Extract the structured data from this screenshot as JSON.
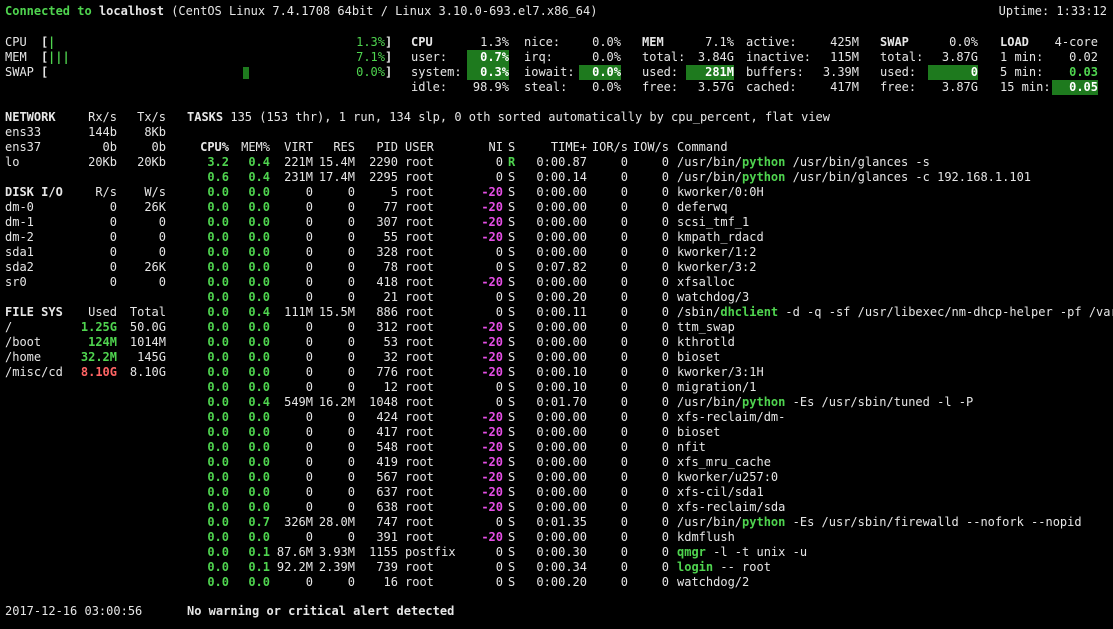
{
  "header": {
    "connected_label": "Connected to",
    "host": "localhost",
    "system": "(CentOS Linux 7.4.1708 64bit / Linux 3.10.0-693.el7.x86_64)",
    "uptime": "Uptime: 1:33:12"
  },
  "quicklook": [
    {
      "label": "CPU",
      "value": "1.3%",
      "fraction": 0.013
    },
    {
      "label": "MEM",
      "value": "7.1%",
      "fraction": 0.071
    },
    {
      "label": "SWAP",
      "value": "0.0%",
      "fraction": 0.0
    }
  ],
  "cpu": {
    "title": "CPU",
    "total": "1.3%",
    "rows": [
      {
        "k1": "user:",
        "v1": "0.7%",
        "k2": "nice:",
        "v2": "0.0%"
      },
      {
        "k1": "system:",
        "v1": "0.3%",
        "k2": "irq:",
        "v2": "0.0%"
      },
      {
        "k1": "idle:",
        "v1": "98.9%",
        "k2": "iowait:",
        "v2": "0.0%"
      },
      {
        "k1": "",
        "v1": "",
        "k2": "steal:",
        "v2": "0.0%"
      }
    ]
  },
  "mem": {
    "title": "MEM",
    "total": "7.1%",
    "rows": [
      {
        "k1": "total:",
        "v1": "3.84G",
        "k2": "active:",
        "v2": "425M"
      },
      {
        "k1": "used:",
        "v1": "281M",
        "k2": "inactive:",
        "v2": "115M"
      },
      {
        "k1": "free:",
        "v1": "3.57G",
        "k2": "buffers:",
        "v2": "3.39M"
      },
      {
        "k1": "",
        "v1": "",
        "k2": "cached:",
        "v2": "417M"
      }
    ]
  },
  "swap": {
    "title": "SWAP",
    "total": "0.0%",
    "rows": [
      {
        "k": "total:",
        "v": "3.87G"
      },
      {
        "k": "used:",
        "v": "0"
      },
      {
        "k": "free:",
        "v": "3.87G"
      }
    ]
  },
  "load": {
    "title": "LOAD",
    "cores": "4-core",
    "rows": [
      {
        "k": "1 min:",
        "v": "0.02"
      },
      {
        "k": "5 min:",
        "v": "0.03"
      },
      {
        "k": "15 min:",
        "v": "0.05"
      }
    ]
  },
  "network": {
    "title": "NETWORK",
    "rx_label": "Rx/s",
    "tx_label": "Tx/s",
    "rows": [
      {
        "name": "ens33",
        "rx": "144b",
        "tx": "8Kb"
      },
      {
        "name": "ens37",
        "rx": "0b",
        "tx": "0b"
      },
      {
        "name": "lo",
        "rx": "20Kb",
        "tx": "20Kb"
      }
    ]
  },
  "diskio": {
    "title": "DISK I/O",
    "r_label": "R/s",
    "w_label": "W/s",
    "rows": [
      {
        "name": "dm-0",
        "r": "0",
        "w": "26K"
      },
      {
        "name": "dm-1",
        "r": "0",
        "w": "0"
      },
      {
        "name": "dm-2",
        "r": "0",
        "w": "0"
      },
      {
        "name": "sda1",
        "r": "0",
        "w": "0"
      },
      {
        "name": "sda2",
        "r": "0",
        "w": "26K"
      },
      {
        "name": "sr0",
        "r": "0",
        "w": "0"
      }
    ]
  },
  "fs": {
    "title": "FILE SYS",
    "used_label": "Used",
    "total_label": "Total",
    "rows": [
      {
        "name": "/",
        "used": "1.25G",
        "total": "50.0G",
        "level": "ok"
      },
      {
        "name": "/boot",
        "used": "124M",
        "total": "1014M",
        "level": "ok"
      },
      {
        "name": "/home",
        "used": "32.2M",
        "total": "145G",
        "level": "ok"
      },
      {
        "name": "/misc/cd",
        "used": "8.10G",
        "total": "8.10G",
        "level": "critical"
      }
    ]
  },
  "tasks": {
    "title": "TASKS",
    "summary": "135 (153 thr), 1 run, 134 slp, 0 oth sorted automatically by cpu_percent, flat view"
  },
  "proc_headers": {
    "cpu": "CPU%",
    "mem": "MEM%",
    "virt": "VIRT",
    "res": "RES",
    "pid": "PID",
    "user": "USER",
    "ni": "NI",
    "s": "S",
    "time": "TIME+",
    "ior": "IOR/s",
    "iow": "IOW/s",
    "cmd": "Command"
  },
  "processes": [
    {
      "cpu": "3.2",
      "mem": "0.4",
      "virt": "221M",
      "res": "15.4M",
      "pid": "2290",
      "user": "root",
      "ni": "0",
      "s": "R",
      "time": "0:00.87",
      "ior": "0",
      "iow": "0",
      "cmd_pre": "/usr/bin/",
      "cmd_hl": "python",
      "cmd_post": " /usr/bin/glances -s"
    },
    {
      "cpu": "0.6",
      "mem": "0.4",
      "virt": "231M",
      "res": "17.4M",
      "pid": "2295",
      "user": "root",
      "ni": "0",
      "s": "S",
      "time": "0:00.14",
      "ior": "0",
      "iow": "0",
      "cmd_pre": "/usr/bin/",
      "cmd_hl": "python",
      "cmd_post": " /usr/bin/glances -c 192.168.1.101"
    },
    {
      "cpu": "0.0",
      "mem": "0.0",
      "virt": "0",
      "res": "0",
      "pid": "5",
      "user": "root",
      "ni": "-20",
      "s": "S",
      "time": "0:00.00",
      "ior": "0",
      "iow": "0",
      "cmd_pre": "kworker/0:0H",
      "cmd_hl": "",
      "cmd_post": ""
    },
    {
      "cpu": "0.0",
      "mem": "0.0",
      "virt": "0",
      "res": "0",
      "pid": "77",
      "user": "root",
      "ni": "-20",
      "s": "S",
      "time": "0:00.00",
      "ior": "0",
      "iow": "0",
      "cmd_pre": "deferwq",
      "cmd_hl": "",
      "cmd_post": ""
    },
    {
      "cpu": "0.0",
      "mem": "0.0",
      "virt": "0",
      "res": "0",
      "pid": "307",
      "user": "root",
      "ni": "-20",
      "s": "S",
      "time": "0:00.00",
      "ior": "0",
      "iow": "0",
      "cmd_pre": "scsi_tmf_1",
      "cmd_hl": "",
      "cmd_post": ""
    },
    {
      "cpu": "0.0",
      "mem": "0.0",
      "virt": "0",
      "res": "0",
      "pid": "55",
      "user": "root",
      "ni": "-20",
      "s": "S",
      "time": "0:00.00",
      "ior": "0",
      "iow": "0",
      "cmd_pre": "kmpath_rdacd",
      "cmd_hl": "",
      "cmd_post": ""
    },
    {
      "cpu": "0.0",
      "mem": "0.0",
      "virt": "0",
      "res": "0",
      "pid": "328",
      "user": "root",
      "ni": "0",
      "s": "S",
      "time": "0:00.00",
      "ior": "0",
      "iow": "0",
      "cmd_pre": "kworker/1:2",
      "cmd_hl": "",
      "cmd_post": ""
    },
    {
      "cpu": "0.0",
      "mem": "0.0",
      "virt": "0",
      "res": "0",
      "pid": "78",
      "user": "root",
      "ni": "0",
      "s": "S",
      "time": "0:07.82",
      "ior": "0",
      "iow": "0",
      "cmd_pre": "kworker/3:2",
      "cmd_hl": "",
      "cmd_post": ""
    },
    {
      "cpu": "0.0",
      "mem": "0.0",
      "virt": "0",
      "res": "0",
      "pid": "418",
      "user": "root",
      "ni": "-20",
      "s": "S",
      "time": "0:00.00",
      "ior": "0",
      "iow": "0",
      "cmd_pre": "xfsalloc",
      "cmd_hl": "",
      "cmd_post": ""
    },
    {
      "cpu": "0.0",
      "mem": "0.0",
      "virt": "0",
      "res": "0",
      "pid": "21",
      "user": "root",
      "ni": "0",
      "s": "S",
      "time": "0:00.20",
      "ior": "0",
      "iow": "0",
      "cmd_pre": "watchdog/3",
      "cmd_hl": "",
      "cmd_post": ""
    },
    {
      "cpu": "0.0",
      "mem": "0.4",
      "virt": "111M",
      "res": "15.5M",
      "pid": "886",
      "user": "root",
      "ni": "0",
      "s": "S",
      "time": "0:00.11",
      "ior": "0",
      "iow": "0",
      "cmd_pre": "/sbin/",
      "cmd_hl": "dhclient",
      "cmd_post": " -d -q -sf /usr/libexec/nm-dhcp-helper -pf /var"
    },
    {
      "cpu": "0.0",
      "mem": "0.0",
      "virt": "0",
      "res": "0",
      "pid": "312",
      "user": "root",
      "ni": "-20",
      "s": "S",
      "time": "0:00.00",
      "ior": "0",
      "iow": "0",
      "cmd_pre": "ttm_swap",
      "cmd_hl": "",
      "cmd_post": ""
    },
    {
      "cpu": "0.0",
      "mem": "0.0",
      "virt": "0",
      "res": "0",
      "pid": "53",
      "user": "root",
      "ni": "-20",
      "s": "S",
      "time": "0:00.00",
      "ior": "0",
      "iow": "0",
      "cmd_pre": "kthrotld",
      "cmd_hl": "",
      "cmd_post": ""
    },
    {
      "cpu": "0.0",
      "mem": "0.0",
      "virt": "0",
      "res": "0",
      "pid": "32",
      "user": "root",
      "ni": "-20",
      "s": "S",
      "time": "0:00.00",
      "ior": "0",
      "iow": "0",
      "cmd_pre": "bioset",
      "cmd_hl": "",
      "cmd_post": ""
    },
    {
      "cpu": "0.0",
      "mem": "0.0",
      "virt": "0",
      "res": "0",
      "pid": "776",
      "user": "root",
      "ni": "-20",
      "s": "S",
      "time": "0:00.10",
      "ior": "0",
      "iow": "0",
      "cmd_pre": "kworker/3:1H",
      "cmd_hl": "",
      "cmd_post": ""
    },
    {
      "cpu": "0.0",
      "mem": "0.0",
      "virt": "0",
      "res": "0",
      "pid": "12",
      "user": "root",
      "ni": "0",
      "s": "S",
      "time": "0:00.10",
      "ior": "0",
      "iow": "0",
      "cmd_pre": "migration/1",
      "cmd_hl": "",
      "cmd_post": ""
    },
    {
      "cpu": "0.0",
      "mem": "0.4",
      "virt": "549M",
      "res": "16.2M",
      "pid": "1048",
      "user": "root",
      "ni": "0",
      "s": "S",
      "time": "0:01.70",
      "ior": "0",
      "iow": "0",
      "cmd_pre": "/usr/bin/",
      "cmd_hl": "python",
      "cmd_post": " -Es /usr/sbin/tuned -l -P"
    },
    {
      "cpu": "0.0",
      "mem": "0.0",
      "virt": "0",
      "res": "0",
      "pid": "424",
      "user": "root",
      "ni": "-20",
      "s": "S",
      "time": "0:00.00",
      "ior": "0",
      "iow": "0",
      "cmd_pre": "xfs-reclaim/dm-",
      "cmd_hl": "",
      "cmd_post": ""
    },
    {
      "cpu": "0.0",
      "mem": "0.0",
      "virt": "0",
      "res": "0",
      "pid": "417",
      "user": "root",
      "ni": "-20",
      "s": "S",
      "time": "0:00.00",
      "ior": "0",
      "iow": "0",
      "cmd_pre": "bioset",
      "cmd_hl": "",
      "cmd_post": ""
    },
    {
      "cpu": "0.0",
      "mem": "0.0",
      "virt": "0",
      "res": "0",
      "pid": "548",
      "user": "root",
      "ni": "-20",
      "s": "S",
      "time": "0:00.00",
      "ior": "0",
      "iow": "0",
      "cmd_pre": "nfit",
      "cmd_hl": "",
      "cmd_post": ""
    },
    {
      "cpu": "0.0",
      "mem": "0.0",
      "virt": "0",
      "res": "0",
      "pid": "419",
      "user": "root",
      "ni": "-20",
      "s": "S",
      "time": "0:00.00",
      "ior": "0",
      "iow": "0",
      "cmd_pre": "xfs_mru_cache",
      "cmd_hl": "",
      "cmd_post": ""
    },
    {
      "cpu": "0.0",
      "mem": "0.0",
      "virt": "0",
      "res": "0",
      "pid": "567",
      "user": "root",
      "ni": "-20",
      "s": "S",
      "time": "0:00.00",
      "ior": "0",
      "iow": "0",
      "cmd_pre": "kworker/u257:0",
      "cmd_hl": "",
      "cmd_post": ""
    },
    {
      "cpu": "0.0",
      "mem": "0.0",
      "virt": "0",
      "res": "0",
      "pid": "637",
      "user": "root",
      "ni": "-20",
      "s": "S",
      "time": "0:00.00",
      "ior": "0",
      "iow": "0",
      "cmd_pre": "xfs-cil/sda1",
      "cmd_hl": "",
      "cmd_post": ""
    },
    {
      "cpu": "0.0",
      "mem": "0.0",
      "virt": "0",
      "res": "0",
      "pid": "638",
      "user": "root",
      "ni": "-20",
      "s": "S",
      "time": "0:00.00",
      "ior": "0",
      "iow": "0",
      "cmd_pre": "xfs-reclaim/sda",
      "cmd_hl": "",
      "cmd_post": ""
    },
    {
      "cpu": "0.0",
      "mem": "0.7",
      "virt": "326M",
      "res": "28.0M",
      "pid": "747",
      "user": "root",
      "ni": "0",
      "s": "S",
      "time": "0:01.35",
      "ior": "0",
      "iow": "0",
      "cmd_pre": "/usr/bin/",
      "cmd_hl": "python",
      "cmd_post": " -Es /usr/sbin/firewalld --nofork --nopid"
    },
    {
      "cpu": "0.0",
      "mem": "0.0",
      "virt": "0",
      "res": "0",
      "pid": "391",
      "user": "root",
      "ni": "-20",
      "s": "S",
      "time": "0:00.00",
      "ior": "0",
      "iow": "0",
      "cmd_pre": "kdmflush",
      "cmd_hl": "",
      "cmd_post": ""
    },
    {
      "cpu": "0.0",
      "mem": "0.1",
      "virt": "87.6M",
      "res": "3.93M",
      "pid": "1155",
      "user": "postfix",
      "ni": "0",
      "s": "S",
      "time": "0:00.30",
      "ior": "0",
      "iow": "0",
      "cmd_pre": "",
      "cmd_hl": "qmgr",
      "cmd_post": " -l -t unix -u"
    },
    {
      "cpu": "0.0",
      "mem": "0.1",
      "virt": "92.2M",
      "res": "2.39M",
      "pid": "739",
      "user": "root",
      "ni": "0",
      "s": "S",
      "time": "0:00.34",
      "ior": "0",
      "iow": "0",
      "cmd_pre": "",
      "cmd_hl": "login",
      "cmd_post": " -- root"
    },
    {
      "cpu": "0.0",
      "mem": "0.0",
      "virt": "0",
      "res": "0",
      "pid": "16",
      "user": "root",
      "ni": "0",
      "s": "S",
      "time": "0:00.20",
      "ior": "0",
      "iow": "0",
      "cmd_pre": "watchdog/2",
      "cmd_hl": "",
      "cmd_post": ""
    }
  ],
  "footer": {
    "datetime": "2017-12-16 03:00:56",
    "alert": "No warning or critical alert detected"
  },
  "colors": {
    "background": "#000000",
    "ok": "#4fd44f",
    "nice_negative": "#e64fe6",
    "critical": "#ff6464",
    "highlight_bg": "#1e7a1e"
  }
}
